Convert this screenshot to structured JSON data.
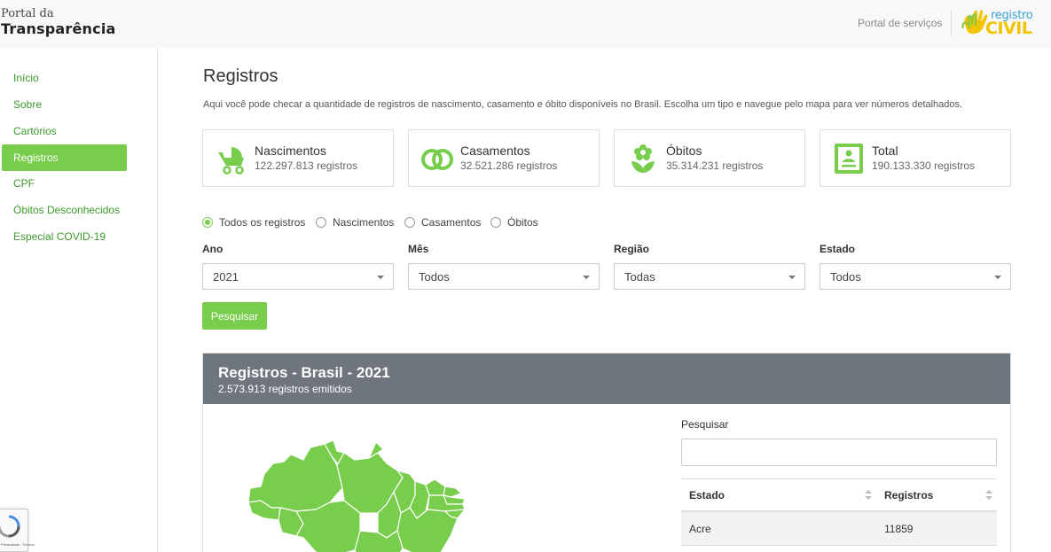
{
  "header": {
    "brand_top": "Portal da",
    "brand_main": "Transparência",
    "portal_link": "Portal de serviços",
    "logo_top": "registro",
    "logo_main": "CIVIL"
  },
  "sidebar": {
    "items": [
      {
        "label": "Início",
        "active": false
      },
      {
        "label": "Sobre",
        "active": false
      },
      {
        "label": "Cartórios",
        "active": false
      },
      {
        "label": "Registros",
        "active": true
      },
      {
        "label": "CPF",
        "active": false
      },
      {
        "label": "Óbitos Desconhecidos",
        "active": false
      },
      {
        "label": "Especial COVID-19",
        "active": false
      }
    ]
  },
  "main": {
    "title": "Registros",
    "description": "Aqui você pode checar a quantidade de registros de nascimento, casamento e óbito disponíveis no Brasil. Escolha um tipo e navegue pelo mapa para ver números detalhados.",
    "cards": [
      {
        "title": "Nascimentos",
        "sub": "122.297.813 registros",
        "icon": "stroller-icon"
      },
      {
        "title": "Casamentos",
        "sub": "32.521.286 registros",
        "icon": "rings-icon"
      },
      {
        "title": "Óbitos",
        "sub": "35.314.231 registros",
        "icon": "flower-icon"
      },
      {
        "title": "Total",
        "sub": "190.133.330 registros",
        "icon": "document-icon"
      }
    ],
    "radios": [
      {
        "label": "Todos os registros",
        "checked": true
      },
      {
        "label": "Nascimentos",
        "checked": false
      },
      {
        "label": "Casamentos",
        "checked": false
      },
      {
        "label": "Óbitos",
        "checked": false
      }
    ],
    "filters": [
      {
        "label": "Ano",
        "value": "2021"
      },
      {
        "label": "Mês",
        "value": "Todos"
      },
      {
        "label": "Região",
        "value": "Todas"
      },
      {
        "label": "Estado",
        "value": "Todos"
      }
    ],
    "search_button": "Pesquisar"
  },
  "panel": {
    "title": "Registros - Brasil - 2021",
    "subtitle": "2.573.913 registros emitidos",
    "search_label": "Pesquisar",
    "search_value": "",
    "table": {
      "headers": [
        "Estado",
        "Registros"
      ],
      "rows": [
        [
          "Acre",
          "11859"
        ]
      ]
    }
  },
  "colors": {
    "accent": "#79cd4c",
    "link": "#3c9a2b",
    "panel_header": "#6e757c",
    "logo_blue": "#3aa3d4",
    "logo_yellow": "#f2c400"
  },
  "recaptcha": {
    "text": "Privacidade - Termos"
  }
}
